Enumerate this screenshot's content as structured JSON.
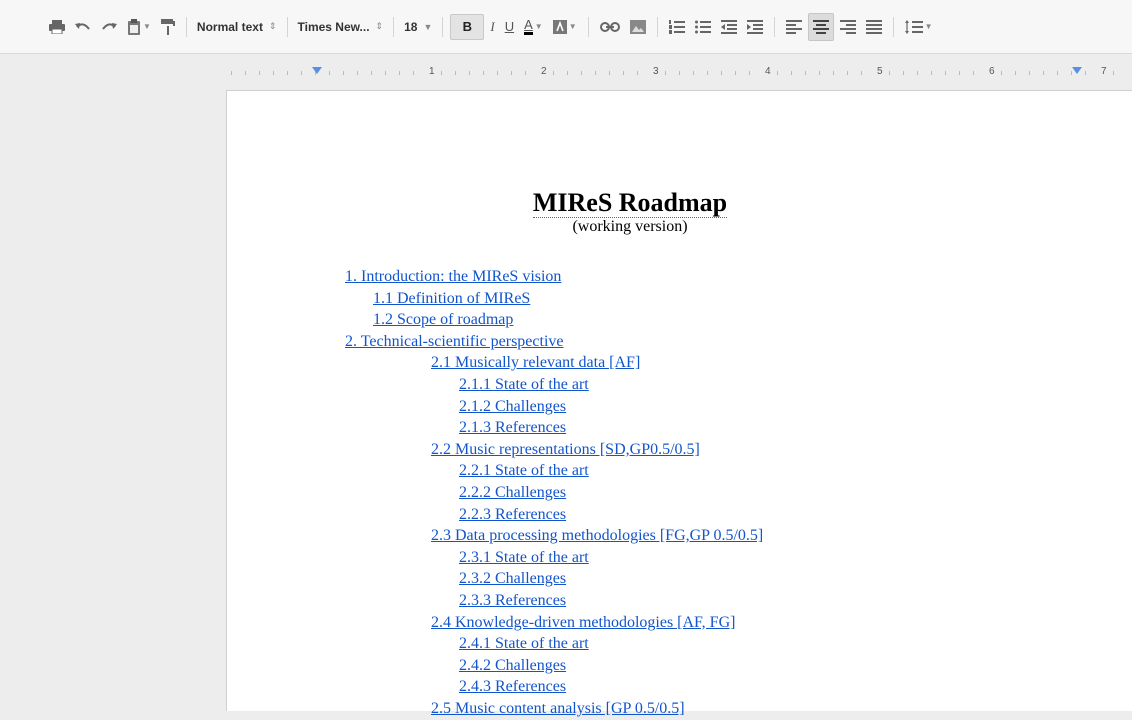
{
  "toolbar": {
    "style_dropdown": "Normal text",
    "font_dropdown": "Times New...",
    "size_dropdown": "18",
    "bold_label": "B",
    "italic_label": "I",
    "underline_label": "U",
    "textcolor_label": "A"
  },
  "ruler": {
    "numbers": [
      "1",
      "2",
      "3",
      "4",
      "5",
      "6",
      "7"
    ]
  },
  "document": {
    "title": "MIReS Roadmap",
    "subtitle": "(working version)",
    "toc": [
      {
        "text": "1. Introduction: the MIReS vision",
        "level": 0
      },
      {
        "text": "1.1 Definition of MIReS",
        "level": 1
      },
      {
        "text": "1.2 Scope of roadmap",
        "level": 1
      },
      {
        "text": "2. Technical-scientific perspective",
        "level": 0
      },
      {
        "text": "2.1 Musically relevant data [AF]",
        "level": 2
      },
      {
        "text": "2.1.1 State of the art",
        "level": 3
      },
      {
        "text": "2.1.2 Challenges",
        "level": 3
      },
      {
        "text": "2.1.3 References",
        "level": 3
      },
      {
        "text": "2.2 Music representations [SD,GP0.5/0.5]",
        "level": 2
      },
      {
        "text": "2.2.1 State of the art",
        "level": 3
      },
      {
        "text": "2.2.2 Challenges",
        "level": 3
      },
      {
        "text": "2.2.3 References",
        "level": 3
      },
      {
        "text": "2.3 Data processing methodologies [FG,GP 0.5/0.5]",
        "level": 2
      },
      {
        "text": "2.3.1 State of the art",
        "level": 3
      },
      {
        "text": "2.3.2 Challenges",
        "level": 3
      },
      {
        "text": "2.3.3 References",
        "level": 3
      },
      {
        "text": "2.4 Knowledge-driven methodologies [AF, FG]",
        "level": 2
      },
      {
        "text": "2.4.1 State of the art",
        "level": 3
      },
      {
        "text": "2.4.2 Challenges",
        "level": 3
      },
      {
        "text": "2.4.3 References",
        "level": 3
      },
      {
        "text": "2.5 Music content analysis [GP 0.5/0.5]",
        "level": 2
      }
    ]
  },
  "colors": {
    "link": "#1155cc",
    "ruler_marker": "#5a8fe8"
  }
}
